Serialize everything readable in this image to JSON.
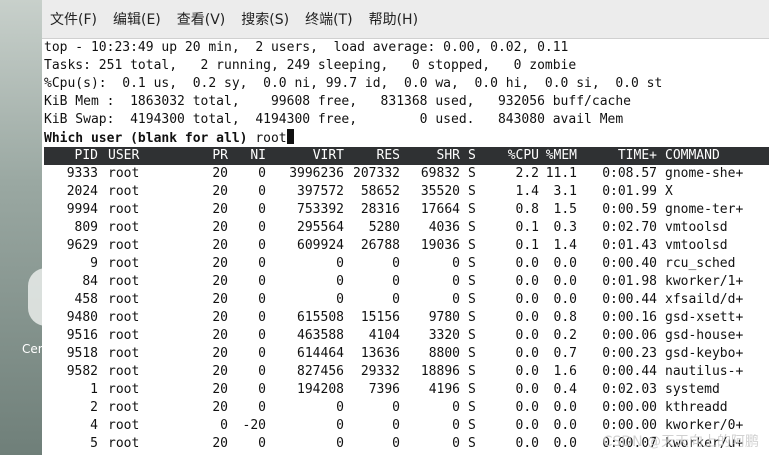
{
  "desktop": {
    "icon_label": "Cen"
  },
  "menu": [
    "文件(F)",
    "编辑(E)",
    "查看(V)",
    "搜索(S)",
    "终端(T)",
    "帮助(H)"
  ],
  "summary": {
    "uptime_line": "top - 10:23:49 up 20 min,  2 users,  load average: 0.00, 0.02, 0.11",
    "tasks_line": "Tasks: 251 total,   2 running, 249 sleeping,   0 stopped,   0 zombie",
    "cpu_line": "%Cpu(s):  0.1 us,  0.2 sy,  0.0 ni, 99.7 id,  0.0 wa,  0.0 hi,  0.0 si,  0.0 st",
    "mem_line": "KiB Mem :  1863032 total,    99608 free,   831368 used,   932056 buff/cache",
    "swap_line": "KiB Swap:  4194300 total,  4194300 free,        0 used.   843080 avail Mem"
  },
  "prompt": {
    "label": "Which user (blank for all)",
    "value": "root"
  },
  "columns": {
    "pid": "PID",
    "user": "USER",
    "pr": "PR",
    "ni": "NI",
    "virt": "VIRT",
    "res": "RES",
    "shr": "SHR",
    "s": "S",
    "cpu": "%CPU",
    "mem": "%MEM",
    "time": "TIME+",
    "cmd": "COMMAND"
  },
  "processes": [
    {
      "pid": "9333",
      "user": "root",
      "pr": "20",
      "ni": "0",
      "virt": "3996236",
      "res": "207332",
      "shr": "69832",
      "s": "S",
      "cpu": "2.2",
      "mem": "11.1",
      "time": "0:08.57",
      "cmd": "gnome-she+"
    },
    {
      "pid": "2024",
      "user": "root",
      "pr": "20",
      "ni": "0",
      "virt": "397572",
      "res": "58652",
      "shr": "35520",
      "s": "S",
      "cpu": "1.4",
      "mem": "3.1",
      "time": "0:01.99",
      "cmd": "X"
    },
    {
      "pid": "9994",
      "user": "root",
      "pr": "20",
      "ni": "0",
      "virt": "753392",
      "res": "28316",
      "shr": "17664",
      "s": "S",
      "cpu": "0.8",
      "mem": "1.5",
      "time": "0:00.59",
      "cmd": "gnome-ter+"
    },
    {
      "pid": "809",
      "user": "root",
      "pr": "20",
      "ni": "0",
      "virt": "295564",
      "res": "5280",
      "shr": "4036",
      "s": "S",
      "cpu": "0.1",
      "mem": "0.3",
      "time": "0:02.70",
      "cmd": "vmtoolsd"
    },
    {
      "pid": "9629",
      "user": "root",
      "pr": "20",
      "ni": "0",
      "virt": "609924",
      "res": "26788",
      "shr": "19036",
      "s": "S",
      "cpu": "0.1",
      "mem": "1.4",
      "time": "0:01.43",
      "cmd": "vmtoolsd"
    },
    {
      "pid": "9",
      "user": "root",
      "pr": "20",
      "ni": "0",
      "virt": "0",
      "res": "0",
      "shr": "0",
      "s": "S",
      "cpu": "0.0",
      "mem": "0.0",
      "time": "0:00.40",
      "cmd": "rcu_sched"
    },
    {
      "pid": "84",
      "user": "root",
      "pr": "20",
      "ni": "0",
      "virt": "0",
      "res": "0",
      "shr": "0",
      "s": "S",
      "cpu": "0.0",
      "mem": "0.0",
      "time": "0:01.98",
      "cmd": "kworker/1+"
    },
    {
      "pid": "458",
      "user": "root",
      "pr": "20",
      "ni": "0",
      "virt": "0",
      "res": "0",
      "shr": "0",
      "s": "S",
      "cpu": "0.0",
      "mem": "0.0",
      "time": "0:00.44",
      "cmd": "xfsaild/d+"
    },
    {
      "pid": "9480",
      "user": "root",
      "pr": "20",
      "ni": "0",
      "virt": "615508",
      "res": "15156",
      "shr": "9780",
      "s": "S",
      "cpu": "0.0",
      "mem": "0.8",
      "time": "0:00.16",
      "cmd": "gsd-xsett+"
    },
    {
      "pid": "9516",
      "user": "root",
      "pr": "20",
      "ni": "0",
      "virt": "463588",
      "res": "4104",
      "shr": "3320",
      "s": "S",
      "cpu": "0.0",
      "mem": "0.2",
      "time": "0:00.06",
      "cmd": "gsd-house+"
    },
    {
      "pid": "9518",
      "user": "root",
      "pr": "20",
      "ni": "0",
      "virt": "614464",
      "res": "13636",
      "shr": "8800",
      "s": "S",
      "cpu": "0.0",
      "mem": "0.7",
      "time": "0:00.23",
      "cmd": "gsd-keybo+"
    },
    {
      "pid": "9582",
      "user": "root",
      "pr": "20",
      "ni": "0",
      "virt": "827456",
      "res": "29332",
      "shr": "18896",
      "s": "S",
      "cpu": "0.0",
      "mem": "1.6",
      "time": "0:00.44",
      "cmd": "nautilus-+"
    },
    {
      "pid": "1",
      "user": "root",
      "pr": "20",
      "ni": "0",
      "virt": "194208",
      "res": "7396",
      "shr": "4196",
      "s": "S",
      "cpu": "0.0",
      "mem": "0.4",
      "time": "0:02.03",
      "cmd": "systemd"
    },
    {
      "pid": "2",
      "user": "root",
      "pr": "20",
      "ni": "0",
      "virt": "0",
      "res": "0",
      "shr": "0",
      "s": "S",
      "cpu": "0.0",
      "mem": "0.0",
      "time": "0:00.00",
      "cmd": "kthreadd"
    },
    {
      "pid": "4",
      "user": "root",
      "pr": "0",
      "ni": "-20",
      "virt": "0",
      "res": "0",
      "shr": "0",
      "s": "S",
      "cpu": "0.0",
      "mem": "0.0",
      "time": "0:00.00",
      "cmd": "kworker/0+"
    },
    {
      "pid": "5",
      "user": "root",
      "pr": "20",
      "ni": "0",
      "virt": "0",
      "res": "0",
      "shr": "0",
      "s": "S",
      "cpu": "0.0",
      "mem": "0.0",
      "time": "0:00.07",
      "cmd": "kworker/u+"
    }
  ],
  "watermark": "CSDN @天天向上的阿鹏",
  "colors": {
    "header_bg": "#2f3133",
    "terminal_bg": "#ffffff",
    "menubar_bg": "#ececec"
  }
}
